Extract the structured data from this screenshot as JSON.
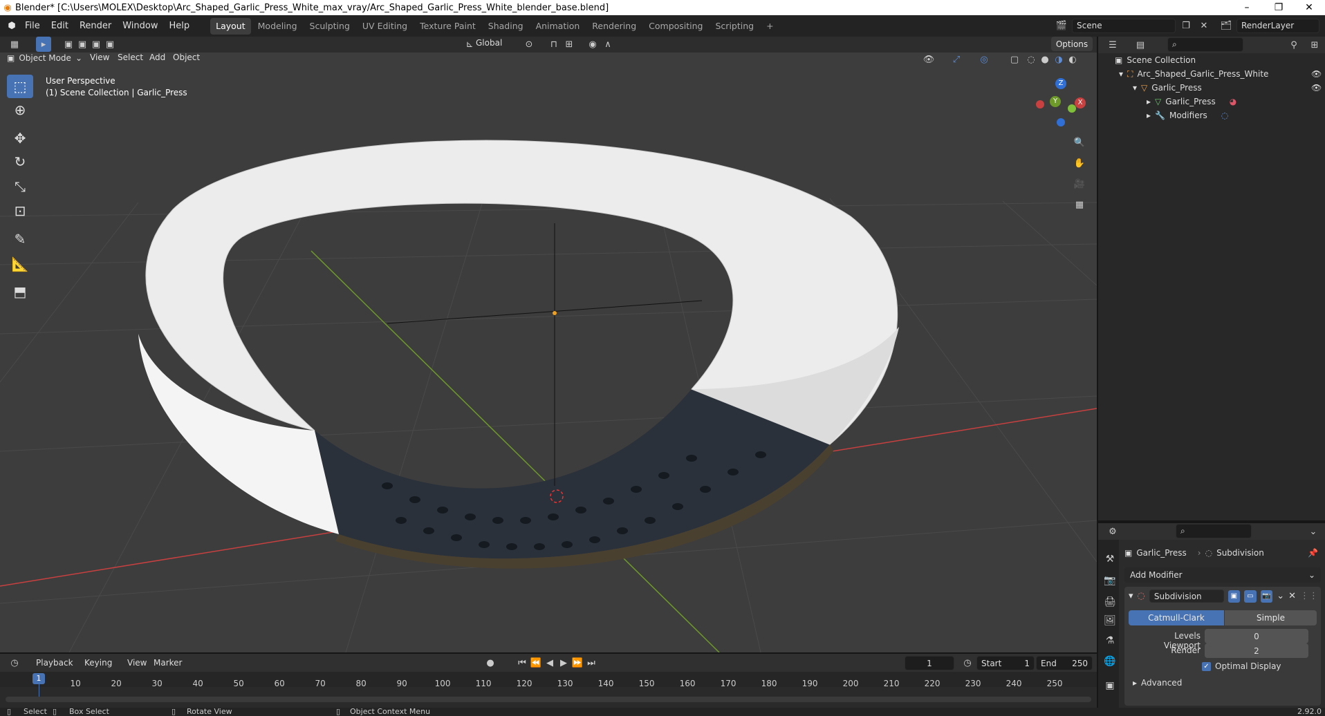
{
  "window": {
    "title": "Blender* [C:\\Users\\MOLEX\\Desktop\\Arc_Shaped_Garlic_Press_White_max_vray/Arc_Shaped_Garlic_Press_White_blender_base.blend]",
    "minimize": "–",
    "restore": "❐",
    "close": "✕"
  },
  "menu": [
    "File",
    "Edit",
    "Render",
    "Window",
    "Help"
  ],
  "workspaces": [
    "Layout",
    "Modeling",
    "Sculpting",
    "UV Editing",
    "Texture Paint",
    "Shading",
    "Animation",
    "Rendering",
    "Compositing",
    "Scripting",
    "+"
  ],
  "scene": {
    "name": "Scene",
    "render_layer": "RenderLayer"
  },
  "viewport": {
    "mode": "Object Mode",
    "menus": [
      "View",
      "Select",
      "Add",
      "Object"
    ],
    "transform_orientation": "Global",
    "options": "Options",
    "overlay_title": "User Perspective",
    "overlay_subtitle": "(1) Scene Collection | Garlic_Press",
    "gizmo": {
      "z": "Z",
      "y": "Y",
      "x": "X"
    }
  },
  "outliner": {
    "root": "Scene Collection",
    "items": [
      {
        "label": "Arc_Shaped_Garlic_Press_White",
        "icon": "collection-icon"
      },
      {
        "label": "Garlic_Press",
        "icon": "object-icon"
      },
      {
        "label": "Garlic_Press",
        "icon": "mesh-data-icon"
      },
      {
        "label": "Modifiers",
        "icon": "wrench-icon"
      }
    ]
  },
  "properties": {
    "object_name": "Garlic_Press",
    "modifier_breadcrumb": "Subdivision",
    "add_modifier": "Add Modifier",
    "modifier": {
      "name": "Subdivision",
      "type_options": [
        "Catmull-Clark",
        "Simple"
      ],
      "selected_type": "Catmull-Clark",
      "levels_viewport_label": "Levels Viewport",
      "levels_viewport": "0",
      "render_label": "Render",
      "render": "2",
      "optimal_display_label": "Optimal Display",
      "optimal_display": true,
      "advanced_label": "Advanced"
    }
  },
  "timeline": {
    "menus": [
      "Playback",
      "Keying",
      "View",
      "Marker"
    ],
    "current_frame": "1",
    "start_label": "Start",
    "start": "1",
    "end_label": "End",
    "end": "250",
    "ruler": [
      "10",
      "20",
      "30",
      "40",
      "50",
      "60",
      "70",
      "80",
      "90",
      "100",
      "110",
      "120",
      "130",
      "140",
      "150",
      "160",
      "170",
      "180",
      "190",
      "200",
      "210",
      "220",
      "230",
      "240",
      "250"
    ],
    "playhead": "1"
  },
  "statusbar": {
    "select": "Select",
    "box_select": "Box Select",
    "rotate_view": "Rotate View",
    "context_menu": "Object Context Menu",
    "version": "2.92.0"
  },
  "colors": {
    "accent": "#4772b3",
    "header": "#303030",
    "viewport_bg": "#3d3d3d",
    "title_orange": "#e87d0d",
    "x_axis": "#c8403f",
    "y_axis": "#6e9a2a"
  }
}
